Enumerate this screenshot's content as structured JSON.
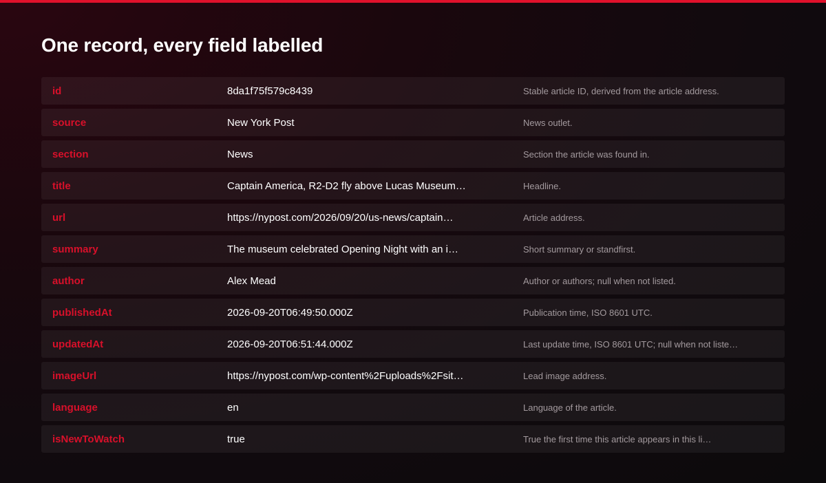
{
  "colors": {
    "accent": "#e0112b",
    "key_text": "#d8102a",
    "value_text": "#ffffff",
    "description_text": "#a39a9e",
    "background": "#110a0e"
  },
  "page": {
    "title": "One record, every field labelled"
  },
  "fields": [
    {
      "key": "id",
      "value": "8da1f75f579c8439",
      "description": "Stable article ID, derived from the article address."
    },
    {
      "key": "source",
      "value": "New York Post",
      "description": "News outlet."
    },
    {
      "key": "section",
      "value": "News",
      "description": "Section the article was found in."
    },
    {
      "key": "title",
      "value": "Captain America, R2-D2 fly above Lucas Museum…",
      "description": "Headline."
    },
    {
      "key": "url",
      "value": "https://nypost.com/2026/09/20/us-news/captain…",
      "description": "Article address."
    },
    {
      "key": "summary",
      "value": "The museum celebrated Opening Night with an i…",
      "description": "Short summary or standfirst."
    },
    {
      "key": "author",
      "value": "Alex Mead",
      "description": "Author or authors; null when not listed."
    },
    {
      "key": "publishedAt",
      "value": "2026-09-20T06:49:50.000Z",
      "description": "Publication time, ISO 8601 UTC."
    },
    {
      "key": "updatedAt",
      "value": "2026-09-20T06:51:44.000Z",
      "description": "Last update time, ISO 8601 UTC; null when not liste…"
    },
    {
      "key": "imageUrl",
      "value": "https://nypost.com/wp-content%2Fuploads%2Fsit…",
      "description": "Lead image address."
    },
    {
      "key": "language",
      "value": "en",
      "description": "Language of the article."
    },
    {
      "key": "isNewToWatch",
      "value": "true",
      "description": "True the first time this article appears in this li…"
    }
  ]
}
